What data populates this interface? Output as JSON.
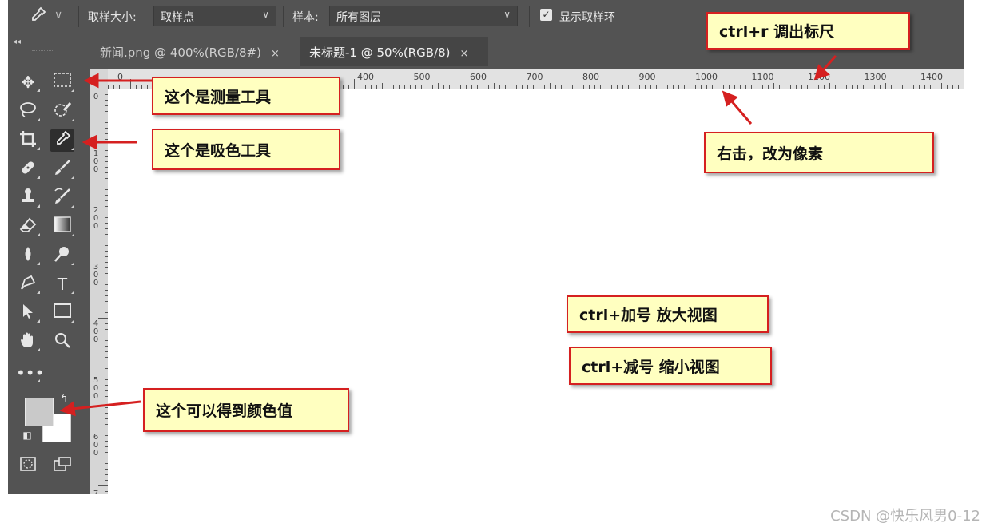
{
  "options_bar": {
    "sample_size_label": "取样大小:",
    "sample_size_value": "取样点",
    "sample_label": "样本:",
    "sample_value": "所有图层",
    "show_ring_label": "显示取样环"
  },
  "tabs": [
    {
      "label": "新闻.png @ 400%(RGB/8#)",
      "close": "×"
    },
    {
      "label": "未标题-1 @ 50%(RGB/8)",
      "close": "×"
    }
  ],
  "ruler": {
    "h_labels": [
      "0",
      "400",
      "500",
      "600",
      "700",
      "800",
      "900",
      "1000",
      "1100",
      "1200",
      "1300",
      "1400"
    ],
    "v_labels": [
      "0",
      "100",
      "200",
      "300",
      "400",
      "500",
      "600",
      "7"
    ]
  },
  "annotations": {
    "measure": "这个是测量工具",
    "eyedropper": "这个是吸色工具",
    "color_value": "这个可以得到颜色值",
    "ruler_shortcut": "ctrl+r 调出标尺",
    "right_click": "右击，改为像素",
    "zoom_in": "ctrl+加号 放大视图",
    "zoom_out": "ctrl+减号 缩小视图"
  },
  "colors": {
    "foreground": "#c9c9c9",
    "background": "#ffffff",
    "note_fill": "#ffffc0",
    "note_border": "#d52020"
  },
  "watermark": "CSDN @快乐风男0-12"
}
